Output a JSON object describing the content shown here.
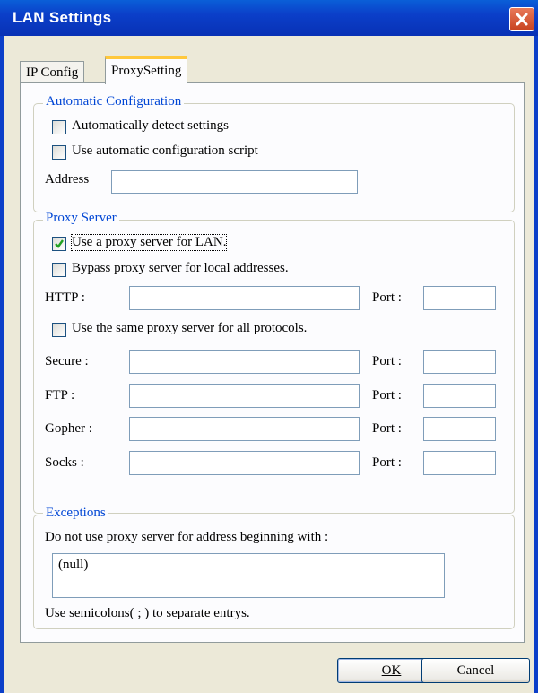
{
  "window": {
    "title": "LAN Settings",
    "close_icon": "close-icon"
  },
  "tabs": [
    {
      "label": "IP Config",
      "selected": false
    },
    {
      "label": "ProxySetting",
      "selected": true
    }
  ],
  "auto_config": {
    "legend": "Automatic Configuration",
    "detect_label": "Automatically detect settings",
    "detect_checked": false,
    "script_label": "Use automatic configuration script",
    "script_checked": false,
    "address_label": "Address",
    "address_value": ""
  },
  "proxy_server": {
    "legend": "Proxy Server",
    "use_proxy_label": "Use a proxy server for LAN.",
    "use_proxy_checked": true,
    "bypass_label": "Bypass proxy server for local addresses.",
    "bypass_checked": false,
    "same_proxy_label": "Use the same proxy server for all protocols.",
    "same_proxy_checked": false,
    "port_label": "Port :",
    "rows": [
      {
        "label": "HTTP :",
        "address": "",
        "port": ""
      },
      {
        "label": "Secure :",
        "address": "",
        "port": ""
      },
      {
        "label": "FTP :",
        "address": "",
        "port": ""
      },
      {
        "label": "Gopher :",
        "address": "",
        "port": ""
      },
      {
        "label": "Socks :",
        "address": "",
        "port": ""
      }
    ]
  },
  "exceptions": {
    "legend": "Exceptions",
    "description": "Do not use proxy server for address beginning with :",
    "value": "(null)",
    "hint": "Use semicolons( ; ) to separate entrys."
  },
  "buttons": {
    "ok": "OK",
    "cancel": "Cancel"
  },
  "colors": {
    "title_bar": "#0b3fc9",
    "legend_text": "#0046d5",
    "dialog_bg": "#ece9d8",
    "close_button": "#d5532f"
  }
}
